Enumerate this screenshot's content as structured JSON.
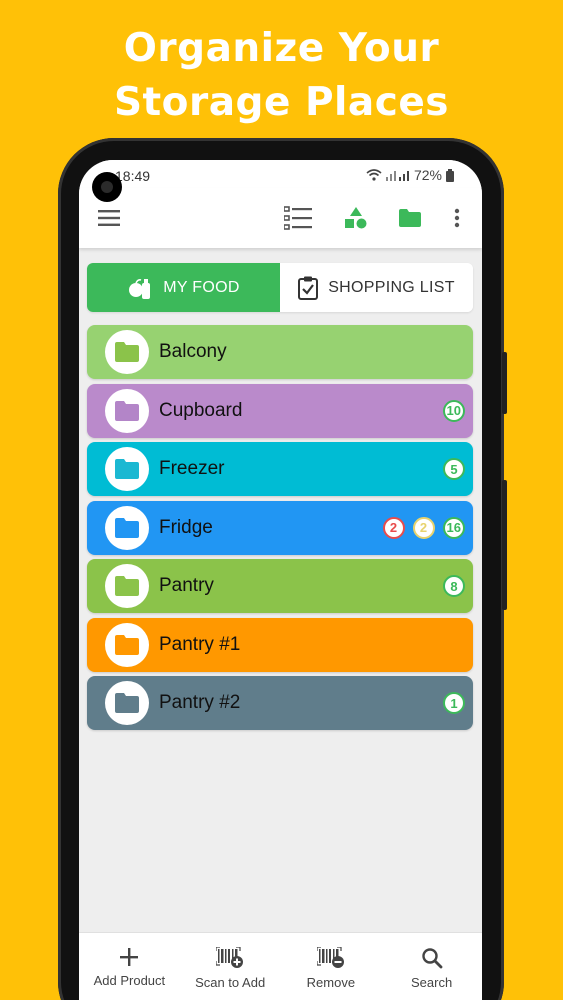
{
  "headline": {
    "line1": "Organize Your",
    "line2": "Storage Places"
  },
  "status": {
    "time": "18:49",
    "battery": "72%"
  },
  "appbar": {
    "icons": [
      "menu-icon",
      "list-view-icon",
      "categories-icon",
      "folder-icon",
      "more-vert-icon"
    ],
    "accent": "#3CB95A"
  },
  "tabs": {
    "my_food": "MY FOOD",
    "shopping_list": "SHOPPING LIST"
  },
  "storages": [
    {
      "name": "Balcony",
      "color": "#97D271",
      "folder_color": "#8BC34A",
      "badges": []
    },
    {
      "name": "Cupboard",
      "color": "#BA8ACB",
      "folder_color": "#B385C8",
      "badges": [
        {
          "value": "10",
          "color": "#3CB95A"
        }
      ]
    },
    {
      "name": "Freezer",
      "color": "#00BCD4",
      "folder_color": "#1BB8D2",
      "badges": [
        {
          "value": "5",
          "color": "#3CB95A"
        }
      ]
    },
    {
      "name": "Fridge",
      "color": "#2196F3",
      "folder_color": "#2196F3",
      "badges": [
        {
          "value": "2",
          "color": "#E84C4C"
        },
        {
          "value": "2",
          "color": "#E8D36E"
        },
        {
          "value": "16",
          "color": "#3CB95A"
        }
      ]
    },
    {
      "name": "Pantry",
      "color": "#8BC34A",
      "folder_color": "#8BC34A",
      "badges": [
        {
          "value": "8",
          "color": "#3CB95A"
        }
      ]
    },
    {
      "name": "Pantry #1",
      "color": "#FF9800",
      "folder_color": "#FF9800",
      "badges": []
    },
    {
      "name": "Pantry #2",
      "color": "#607D8B",
      "folder_color": "#607D8B",
      "badges": [
        {
          "value": "1",
          "color": "#3CB95A"
        }
      ]
    }
  ],
  "bottom_nav": [
    {
      "label": "Add Product",
      "icon": "plus-icon"
    },
    {
      "label": "Scan to Add",
      "icon": "barcode-add-icon"
    },
    {
      "label": "Remove",
      "icon": "barcode-remove-icon"
    },
    {
      "label": "Search",
      "icon": "search-icon"
    }
  ]
}
